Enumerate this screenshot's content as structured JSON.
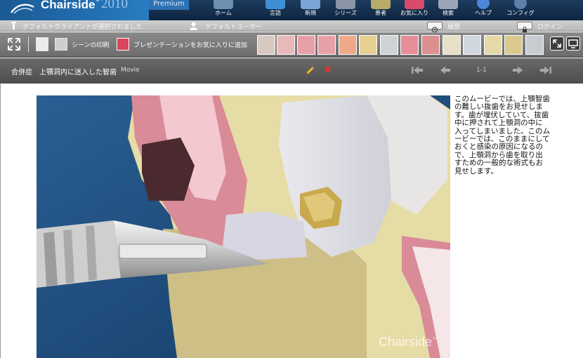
{
  "app": {
    "brand": "Chairside",
    "brand_mark": "®",
    "year": "2010",
    "edition": "Premium",
    "watermark": "Chairside",
    "watermark_mark": "™"
  },
  "nav": [
    {
      "label": "ホーム",
      "icon": "home-icon",
      "color": "#6f8fb0"
    },
    {
      "label": "言語",
      "icon": "language-icon",
      "color": "#3f8fd6"
    },
    {
      "label": "新規",
      "icon": "new-icon",
      "color": "#7aa5d6"
    },
    {
      "label": "シリーズ",
      "icon": "series-icon",
      "color": "#8a96a6"
    },
    {
      "label": "患者",
      "icon": "patient-icon",
      "color": "#b8ab6a"
    },
    {
      "label": "お気に入り",
      "icon": "favorites-icon",
      "color": "#d94a6b"
    },
    {
      "label": "検索",
      "icon": "search-icon",
      "color": "#9aa6b6"
    },
    {
      "label": "ヘルプ",
      "icon": "help-icon",
      "color": "#4b86d8"
    },
    {
      "label": "コンフィグ",
      "icon": "config-icon",
      "color": "#5f7fa8"
    }
  ],
  "status": {
    "client": "デフォルトクライアントが選択されました",
    "user": "デフォルトユーザー",
    "history": "履歴",
    "login": "ログイン"
  },
  "toolbar": {
    "print_label": "シーンの印刷",
    "favorite_label": "プレゼンテーションをお気に入りに追加"
  },
  "thumbnails": [
    {
      "icon": "thumb-cleaning-icon",
      "color": "#d8c9c0"
    },
    {
      "icon": "thumb-crown-icon",
      "color": "#e8b9b9"
    },
    {
      "icon": "thumb-braces-icon",
      "color": "#e79fa8"
    },
    {
      "icon": "thumb-smile-icon",
      "color": "#e8a0a8"
    },
    {
      "icon": "thumb-lips-icon",
      "color": "#f0a88a"
    },
    {
      "icon": "thumb-root-icon",
      "color": "#e6d092"
    },
    {
      "icon": "thumb-tools-icon",
      "color": "#cfd3d6"
    },
    {
      "icon": "thumb-gums-icon",
      "color": "#e68d96"
    },
    {
      "icon": "thumb-gum-disease-icon",
      "color": "#db8f8f"
    },
    {
      "icon": "thumb-denture-icon",
      "color": "#e8dfc8"
    },
    {
      "icon": "thumb-implant-icon",
      "color": "#d0d7de"
    },
    {
      "icon": "thumb-bridge-icon",
      "color": "#e6d9a8"
    },
    {
      "icon": "thumb-xray-icon",
      "color": "#d9c98c"
    },
    {
      "icon": "thumb-instruments-icon",
      "color": "#c8ccd0"
    }
  ],
  "presentation": {
    "category": "合併症",
    "title": "上顎洞内に迷入した智歯",
    "kind": "Movie",
    "page": "1-1"
  },
  "description": "このムービーでは、上顎智歯の難しい抜歯をお見せします。歯が埋伏していて、抜歯中に押されて上顎洞の中に入ってしまいました。このムービーでは、このままにしておくと感染の原因になるので、上顎洞から歯を取り出すための一般的な術式もお見せします。",
  "colors": {
    "video_bg": "#1d4a7c",
    "bone": "#e6dca6",
    "gum": "#d98b98",
    "tooth": "#c9a94e"
  }
}
